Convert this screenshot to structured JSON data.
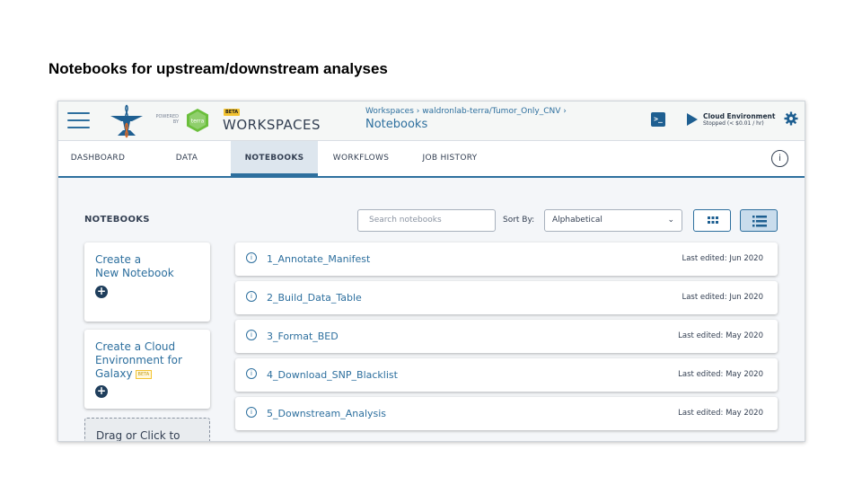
{
  "slide": {
    "title": "Notebooks for upstream/downstream analyses"
  },
  "header": {
    "powered_by": "POWERED BY",
    "terra_label": "terra",
    "beta": "BETA",
    "app_title": "WORKSPACES",
    "breadcrumb": "Workspaces › waldronlab-terra/Tumor_Only_CNV ›",
    "page_title": "Notebooks",
    "terminal_glyph": ">_",
    "cloud_env_title": "Cloud Environment",
    "cloud_env_status": "Stopped (< $0.01 / hr)"
  },
  "tabs": [
    {
      "label": "DASHBOARD"
    },
    {
      "label": "DATA"
    },
    {
      "label": "NOTEBOOKS"
    },
    {
      "label": "WORKFLOWS"
    },
    {
      "label": "JOB HISTORY"
    }
  ],
  "active_tab": "NOTEBOOKS",
  "main": {
    "section_title": "NOTEBOOKS",
    "search_placeholder": "Search notebooks",
    "sort_label": "Sort By:",
    "sort_value": "Alphabetical",
    "create_notebook_line1": "Create a",
    "create_notebook_line2": "New Notebook",
    "create_cloud_line1": "Create a Cloud",
    "create_cloud_line2": "Environment for",
    "create_cloud_line3": "Galaxy",
    "create_cloud_beta": "BETA",
    "drop_text": "Drag or Click to"
  },
  "notebooks": [
    {
      "name": "1_Annotate_Manifest",
      "last_edited": "Last edited: Jun 2020"
    },
    {
      "name": "2_Build_Data_Table",
      "last_edited": "Last edited: Jun 2020"
    },
    {
      "name": "3_Format_BED",
      "last_edited": "Last edited: May 2020"
    },
    {
      "name": "4_Download_SNP_Blacklist",
      "last_edited": "Last edited: May 2020"
    },
    {
      "name": "5_Downstream_Analysis",
      "last_edited": "Last edited: May 2020"
    }
  ],
  "colors": {
    "accent": "#2d6f9e",
    "terra_green": "#6bbf3c",
    "beta_yellow": "#f3c331",
    "dark_navy": "#1f3e5c"
  },
  "icons": [
    "hamburger-icon",
    "anvil-logo-icon",
    "terra-logo-icon",
    "terminal-icon",
    "play-icon",
    "gear-icon",
    "info-icon",
    "chevron-down-icon",
    "grid-view-icon",
    "list-view-icon",
    "plus-circle-icon"
  ]
}
